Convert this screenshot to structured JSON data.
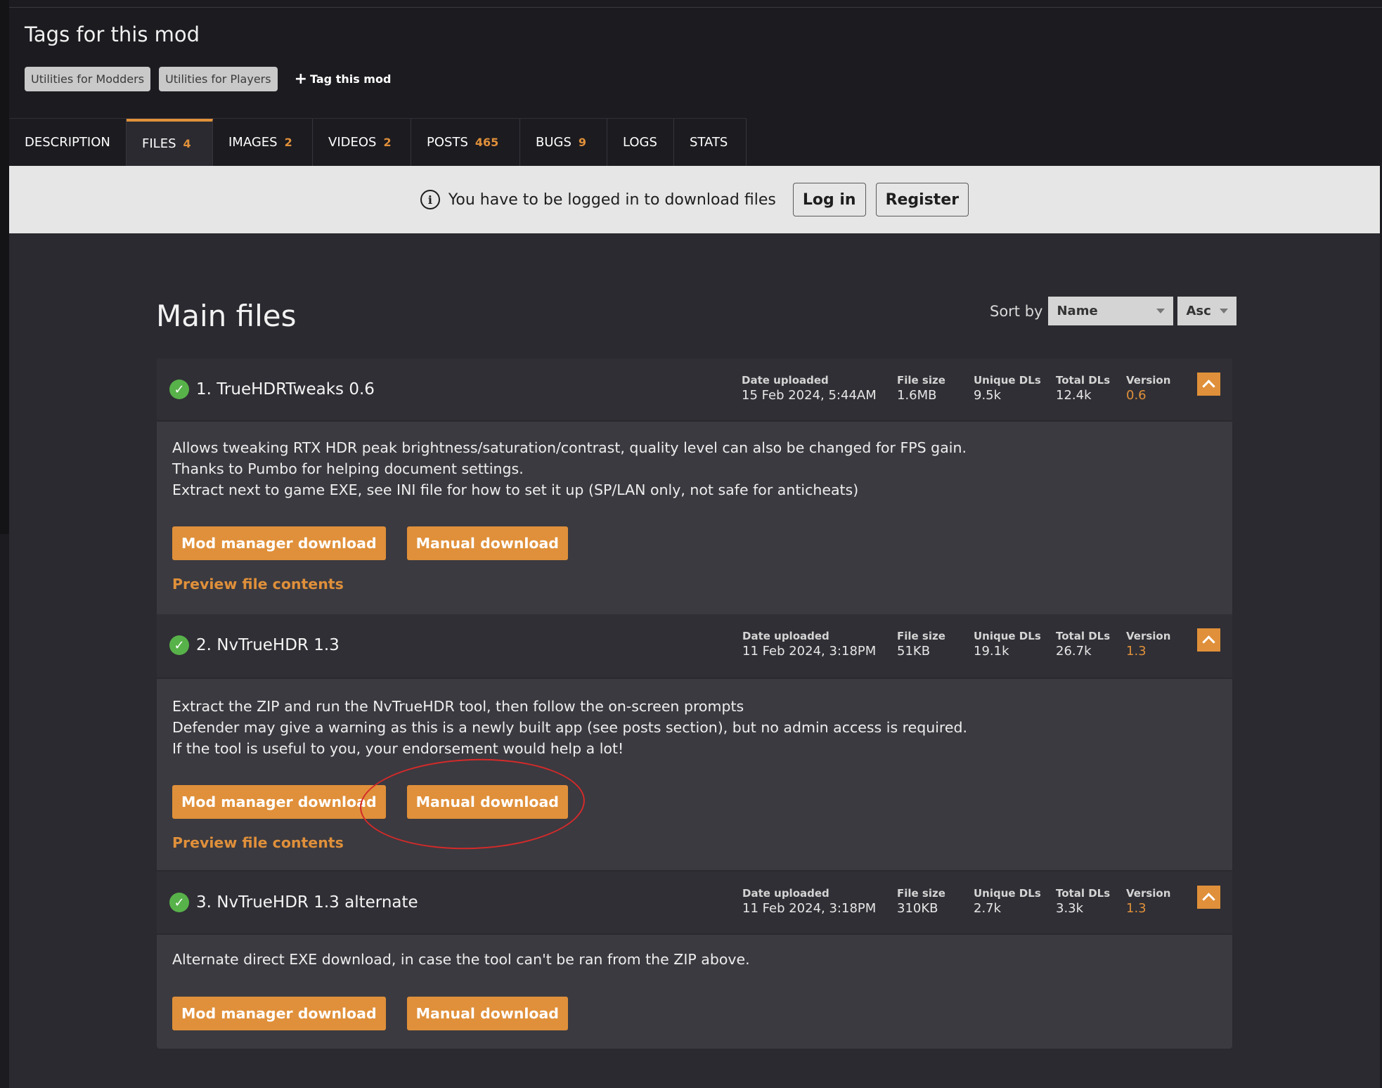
{
  "tags": {
    "title": "Tags for this mod",
    "items": [
      "Utilities for Modders",
      "Utilities for Players"
    ],
    "add_label": "Tag this mod"
  },
  "tabs": [
    {
      "label": "DESCRIPTION",
      "count": ""
    },
    {
      "label": "FILES",
      "count": "4"
    },
    {
      "label": "IMAGES",
      "count": "2"
    },
    {
      "label": "VIDEOS",
      "count": "2"
    },
    {
      "label": "POSTS",
      "count": "465"
    },
    {
      "label": "BUGS",
      "count": "9"
    },
    {
      "label": "LOGS",
      "count": ""
    },
    {
      "label": "STATS",
      "count": ""
    }
  ],
  "login_bar": {
    "message": "You have to be logged in to download files",
    "login_label": "Log in",
    "register_label": "Register"
  },
  "main": {
    "title": "Main files",
    "sort_label": "Sort by",
    "sort_field": "Name",
    "sort_order": "Asc"
  },
  "stat_labels": {
    "date": "Date uploaded",
    "size": "File size",
    "unique": "Unique DLs",
    "total": "Total DLs",
    "version": "Version"
  },
  "buttons": {
    "mod_manager": "Mod manager download",
    "manual": "Manual download",
    "preview": "Preview file contents"
  },
  "files": [
    {
      "name": "1. TrueHDRTweaks 0.6",
      "date": "15 Feb 2024, 5:44AM",
      "size": "1.6MB",
      "unique": "9.5k",
      "total": "12.4k",
      "version": "0.6",
      "desc": [
        "Allows tweaking RTX HDR peak brightness/saturation/contrast, quality level can also be changed for FPS gain.",
        "Thanks to Pumbo for helping document settings.",
        "Extract next to game EXE, see INI file for how to set it up (SP/LAN only, not safe for anticheats)"
      ]
    },
    {
      "name": "2. NvTrueHDR 1.3",
      "date": "11 Feb 2024, 3:18PM",
      "size": "51KB",
      "unique": "19.1k",
      "total": "26.7k",
      "version": "1.3",
      "desc": [
        "Extract the ZIP and run the NvTrueHDR tool, then follow the on-screen prompts",
        "Defender may give a warning as this is a newly built app (see posts section), but no admin access is required.",
        "If the tool is useful to you, your endorsement would help a lot!"
      ]
    },
    {
      "name": "3. NvTrueHDR 1.3 alternate",
      "date": "11 Feb 2024, 3:18PM",
      "size": "310KB",
      "unique": "2.7k",
      "total": "3.3k",
      "version": "1.3",
      "desc": [
        "Alternate direct EXE download, in case the tool can't be ran from the ZIP above."
      ]
    }
  ],
  "colors": {
    "accent": "#e0903a",
    "check": "#58b24a",
    "annotation": "#d42a2a"
  }
}
